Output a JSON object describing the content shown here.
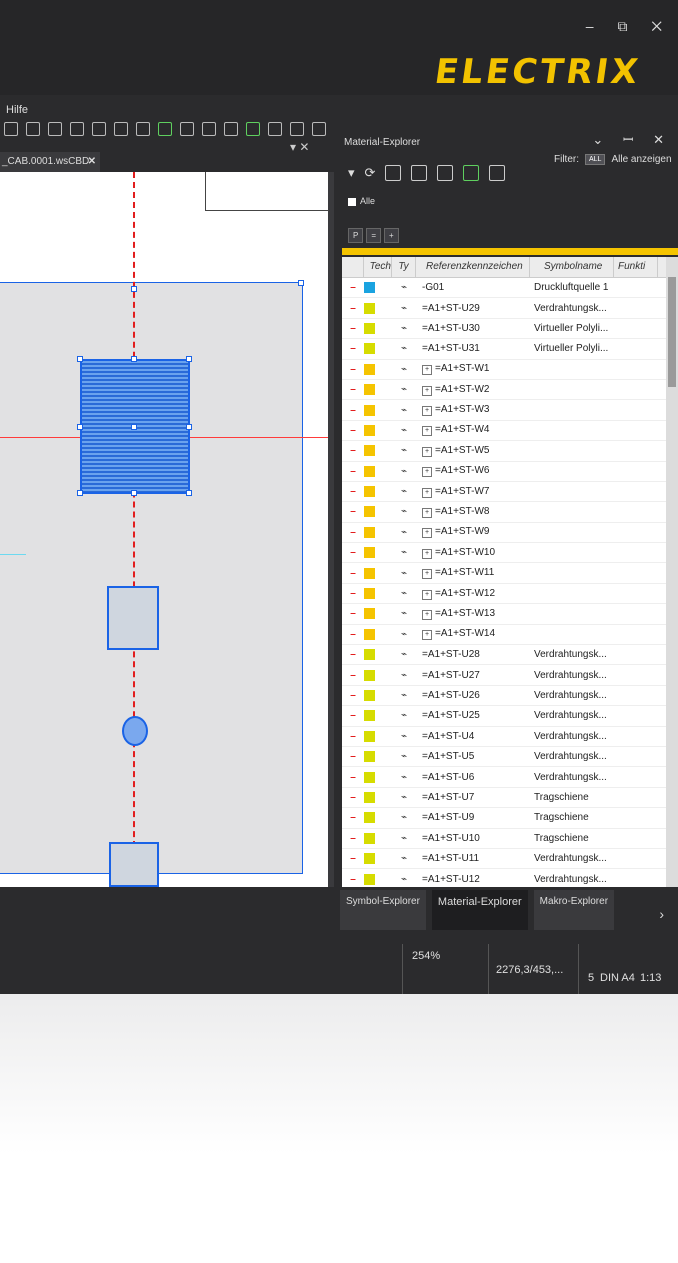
{
  "app": {
    "logo_text": "ELECTRIX",
    "window_controls": "– ⧉ ✕",
    "menu_item": "Hilfe",
    "document_tab": "_CAB.0001.wsCBD",
    "document_tab_close": "✕",
    "canvas_controls": "▾ ✕",
    "accent_color": "#f5c400",
    "selection_color": "#1a63e6"
  },
  "panel": {
    "title": "Material-Explorer",
    "controls": "⌄ ꟷ ✕",
    "filter_label": "Filter:",
    "filter_badge": "ALL",
    "filter_value": "Alle anzeigen",
    "alle_label": "Alle",
    "p_buttons": [
      "P",
      "=",
      "+"
    ],
    "columns": [
      "Tech",
      "Ty",
      "Referenzkennzeichen",
      "Symbolname",
      "Funkti"
    ],
    "rows": [
      {
        "color": "#1aa3e0",
        "ref": "-G01",
        "symbol": "Druckluftquelle 1",
        "plus": false
      },
      {
        "color": "#d6dc00",
        "ref": "=A1+ST-U29",
        "symbol": "Verdrahtungsk...",
        "plus": false
      },
      {
        "color": "#d6dc00",
        "ref": "=A1+ST-U30",
        "symbol": "Virtueller Polyli...",
        "plus": false
      },
      {
        "color": "#d6dc00",
        "ref": "=A1+ST-U31",
        "symbol": "Virtueller Polyli...",
        "plus": false
      },
      {
        "color": "#f5c400",
        "ref": "=A1+ST-W1",
        "symbol": "",
        "plus": true
      },
      {
        "color": "#f5c400",
        "ref": "=A1+ST-W2",
        "symbol": "",
        "plus": true
      },
      {
        "color": "#f5c400",
        "ref": "=A1+ST-W3",
        "symbol": "",
        "plus": true
      },
      {
        "color": "#f5c400",
        "ref": "=A1+ST-W4",
        "symbol": "",
        "plus": true
      },
      {
        "color": "#f5c400",
        "ref": "=A1+ST-W5",
        "symbol": "",
        "plus": true
      },
      {
        "color": "#f5c400",
        "ref": "=A1+ST-W6",
        "symbol": "",
        "plus": true
      },
      {
        "color": "#f5c400",
        "ref": "=A1+ST-W7",
        "symbol": "",
        "plus": true
      },
      {
        "color": "#f5c400",
        "ref": "=A1+ST-W8",
        "symbol": "",
        "plus": true
      },
      {
        "color": "#f5c400",
        "ref": "=A1+ST-W9",
        "symbol": "",
        "plus": true
      },
      {
        "color": "#f5c400",
        "ref": "=A1+ST-W10",
        "symbol": "",
        "plus": true
      },
      {
        "color": "#f5c400",
        "ref": "=A1+ST-W11",
        "symbol": "",
        "plus": true
      },
      {
        "color": "#f5c400",
        "ref": "=A1+ST-W12",
        "symbol": "",
        "plus": true
      },
      {
        "color": "#f5c400",
        "ref": "=A1+ST-W13",
        "symbol": "",
        "plus": true
      },
      {
        "color": "#f5c400",
        "ref": "=A1+ST-W14",
        "symbol": "",
        "plus": true
      },
      {
        "color": "#d6dc00",
        "ref": "=A1+ST-U28",
        "symbol": "Verdrahtungsk...",
        "plus": false
      },
      {
        "color": "#d6dc00",
        "ref": "=A1+ST-U27",
        "symbol": "Verdrahtungsk...",
        "plus": false
      },
      {
        "color": "#d6dc00",
        "ref": "=A1+ST-U26",
        "symbol": "Verdrahtungsk...",
        "plus": false
      },
      {
        "color": "#d6dc00",
        "ref": "=A1+ST-U25",
        "symbol": "Verdrahtungsk...",
        "plus": false
      },
      {
        "color": "#d6dc00",
        "ref": "=A1+ST-U4",
        "symbol": "Verdrahtungsk...",
        "plus": false
      },
      {
        "color": "#d6dc00",
        "ref": "=A1+ST-U5",
        "symbol": "Verdrahtungsk...",
        "plus": false
      },
      {
        "color": "#d6dc00",
        "ref": "=A1+ST-U6",
        "symbol": "Verdrahtungsk...",
        "plus": false
      },
      {
        "color": "#d6dc00",
        "ref": "=A1+ST-U7",
        "symbol": "Tragschiene",
        "plus": false
      },
      {
        "color": "#d6dc00",
        "ref": "=A1+ST-U9",
        "symbol": "Tragschiene",
        "plus": false
      },
      {
        "color": "#d6dc00",
        "ref": "=A1+ST-U10",
        "symbol": "Tragschiene",
        "plus": false
      },
      {
        "color": "#d6dc00",
        "ref": "=A1+ST-U11",
        "symbol": "Verdrahtungsk...",
        "plus": false
      },
      {
        "color": "#d6dc00",
        "ref": "=A1+ST-U12",
        "symbol": "Verdrahtungsk...",
        "plus": false
      }
    ],
    "bottom_tabs": [
      "Symbol-Explorer",
      "Material-Explorer",
      "Makro-Explorer"
    ],
    "active_tab": "Material-Explorer"
  },
  "status": {
    "zoom": "254%",
    "coords": "2276,3/453,...",
    "page": "5",
    "format": "DIN A4",
    "scale": "1:13"
  }
}
